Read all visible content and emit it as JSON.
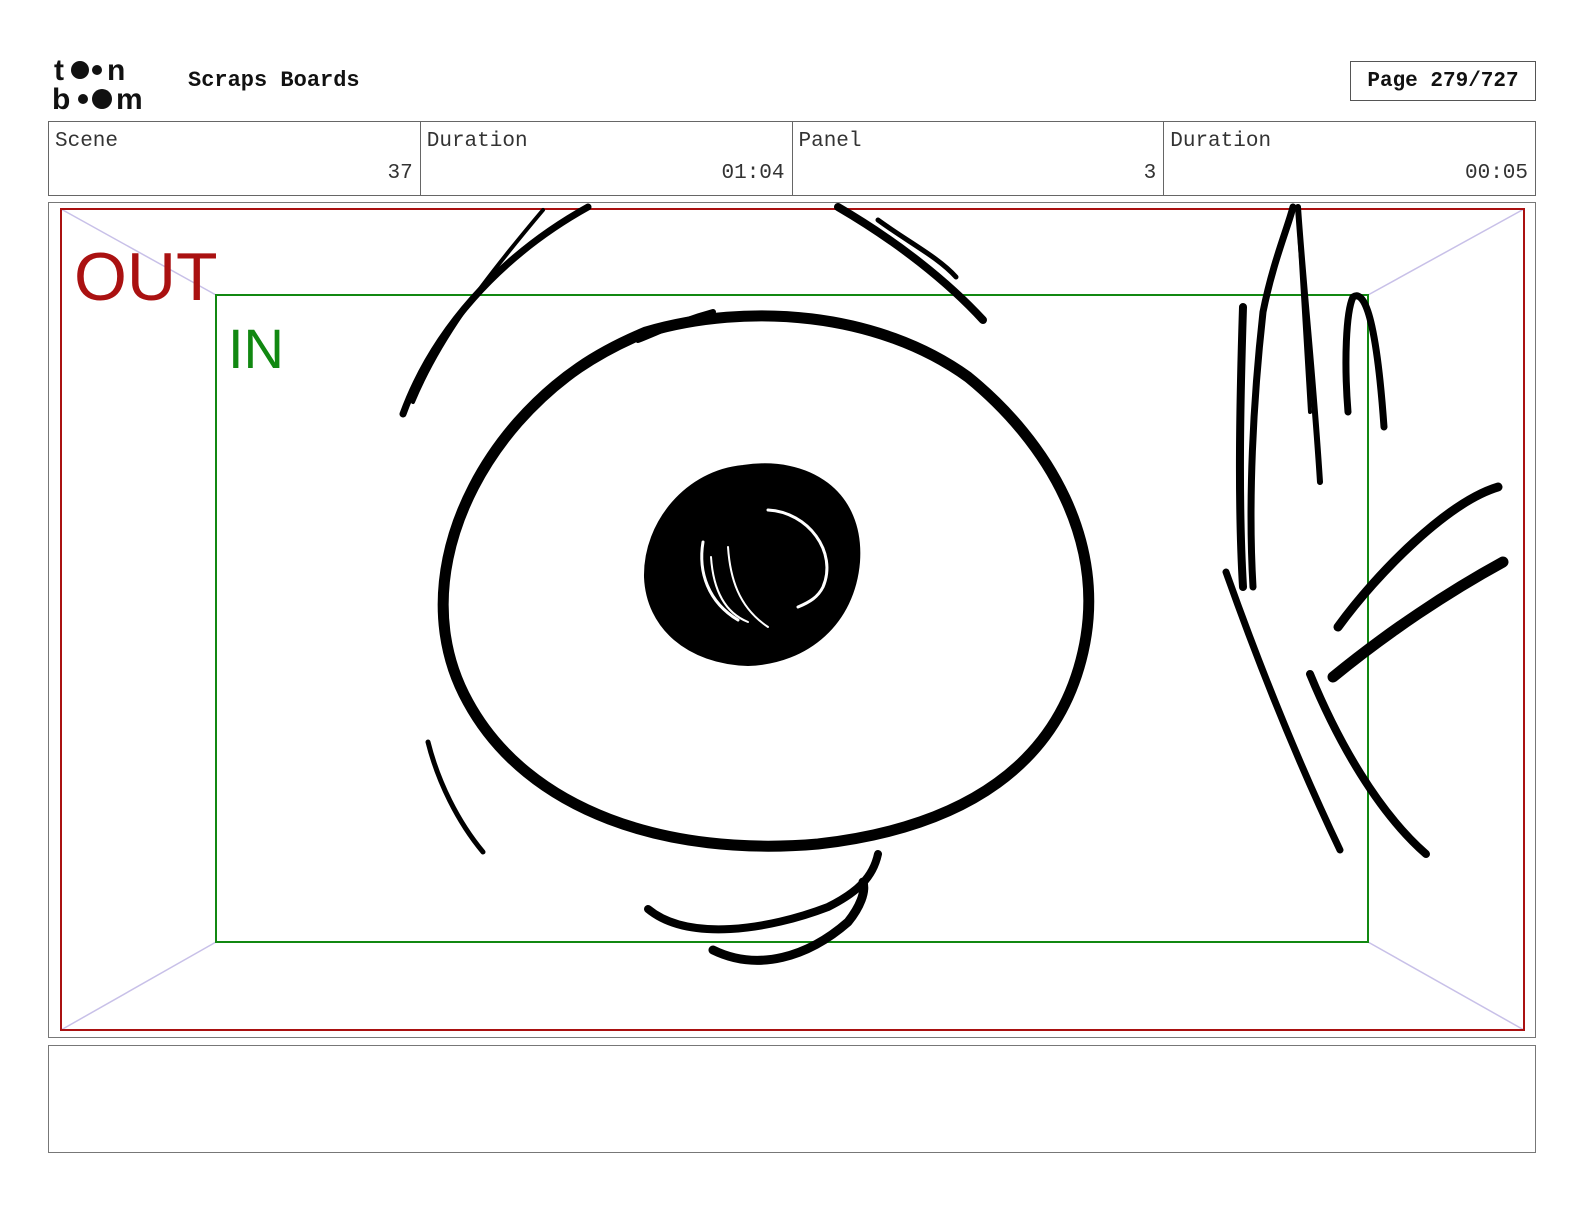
{
  "header": {
    "logo_text": "toon boom",
    "title": "Scraps Boards",
    "page": "Page 279/727"
  },
  "info": {
    "scene_label": "Scene",
    "scene_value": "37",
    "scene_duration_label": "Duration",
    "scene_duration_value": "01:04",
    "panel_label": "Panel",
    "panel_value": "3",
    "panel_duration_label": "Duration",
    "panel_duration_value": "00:05"
  },
  "frame": {
    "out_label": "OUT",
    "in_label": "IN",
    "out_color": "#aa1111",
    "in_color": "#118811",
    "guide_color": "#c8c0e8"
  },
  "notes": {
    "text": ""
  }
}
